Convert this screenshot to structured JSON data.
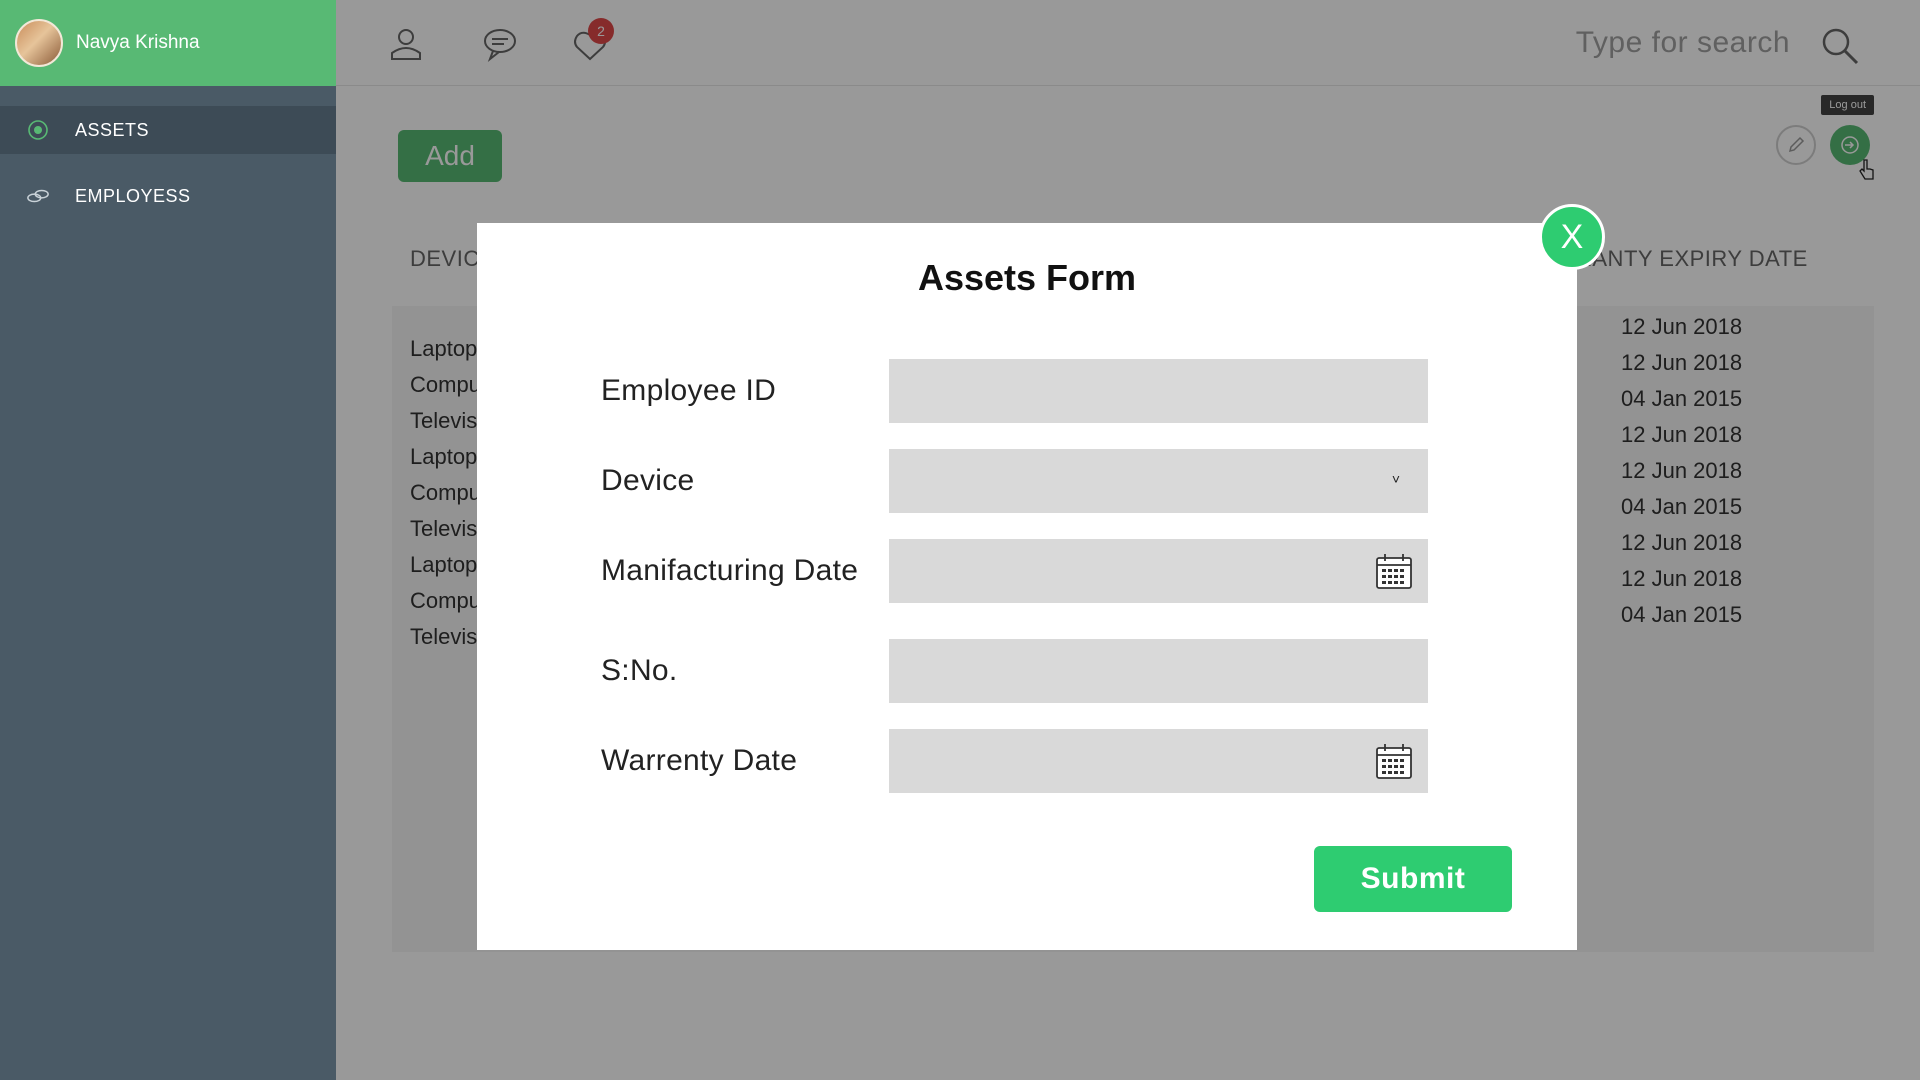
{
  "user": {
    "name": "Navya Krishna"
  },
  "sidebar": {
    "items": [
      {
        "label": "ASSETS",
        "icon": "target-icon",
        "active": true
      },
      {
        "label": "EMPLOYESS",
        "icon": "link-icon",
        "active": false
      }
    ]
  },
  "topbar": {
    "notification_count": "2",
    "search_placeholder": "Type for search"
  },
  "toolbar": {
    "add_label": "Add",
    "logout_tooltip": "Log out"
  },
  "table": {
    "headers": {
      "device": "DEVIC",
      "warranty": "RANTY EXPIRY DATE"
    },
    "devices": [
      "Laptop",
      "Compu",
      "Televis",
      "Laptop",
      "Compu",
      "Televis",
      "Laptop",
      "Compu",
      "Televis"
    ],
    "warranty_dates": [
      "12 Jun 2018",
      "12 Jun 2018",
      "04 Jan 2015",
      "12 Jun 2018",
      "12 Jun 2018",
      "04 Jan 2015",
      "12 Jun 2018",
      "12 Jun 2018",
      "04 Jan 2015"
    ]
  },
  "modal": {
    "title": "Assets Form",
    "close_label": "X",
    "fields": [
      {
        "label": "Employee ID",
        "type": "text"
      },
      {
        "label": "Device",
        "type": "select"
      },
      {
        "label": "Manifacturing Date",
        "type": "date"
      },
      {
        "label": "S:No.",
        "type": "text"
      },
      {
        "label": "Warrenty Date",
        "type": "date"
      }
    ],
    "submit_label": "Submit"
  },
  "colors": {
    "accent": "#58b974",
    "submit": "#2ecc71",
    "sidebar": "#4a5a66",
    "badge": "#e04848"
  }
}
